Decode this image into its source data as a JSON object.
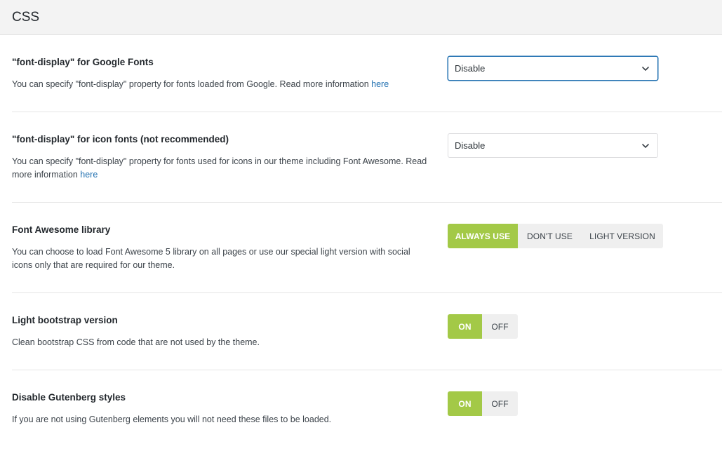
{
  "section": {
    "title": "CSS"
  },
  "colors": {
    "accent": "#a3c947",
    "link": "#2271b1",
    "focus_border": "#2271b1",
    "header_bg": "#f3f3f3"
  },
  "icons": {
    "dropdown": "chevron-down-icon"
  },
  "settings": {
    "google_font_display": {
      "label": "\"font-display\" for Google Fonts",
      "desc": "You can specify \"font-display\" property for fonts loaded from Google. Read more information ",
      "link_text": "here",
      "selected": "Disable"
    },
    "icon_font_display": {
      "label": "\"font-display\" for icon fonts (not recommended)",
      "desc": "You can specify \"font-display\" property for fonts used for icons in our theme including Font Awesome. Read more information ",
      "link_text": "here",
      "selected": "Disable"
    },
    "font_awesome": {
      "label": "Font Awesome library",
      "desc": "You can choose to load Font Awesome 5 library on all pages or use our special light version with social icons only that are required for our theme.",
      "options": [
        "ALWAYS USE",
        "DON'T USE",
        "LIGHT VERSION"
      ],
      "selected": "ALWAYS USE"
    },
    "light_bootstrap": {
      "label": "Light bootstrap version",
      "desc": "Clean bootstrap CSS from code that are not used by the theme.",
      "on_label": "ON",
      "off_label": "OFF",
      "selected": "ON"
    },
    "disable_gutenberg": {
      "label": "Disable Gutenberg styles",
      "desc": "If you are not using Gutenberg elements you will not need these files to be loaded.",
      "on_label": "ON",
      "off_label": "OFF",
      "selected": "ON"
    }
  }
}
